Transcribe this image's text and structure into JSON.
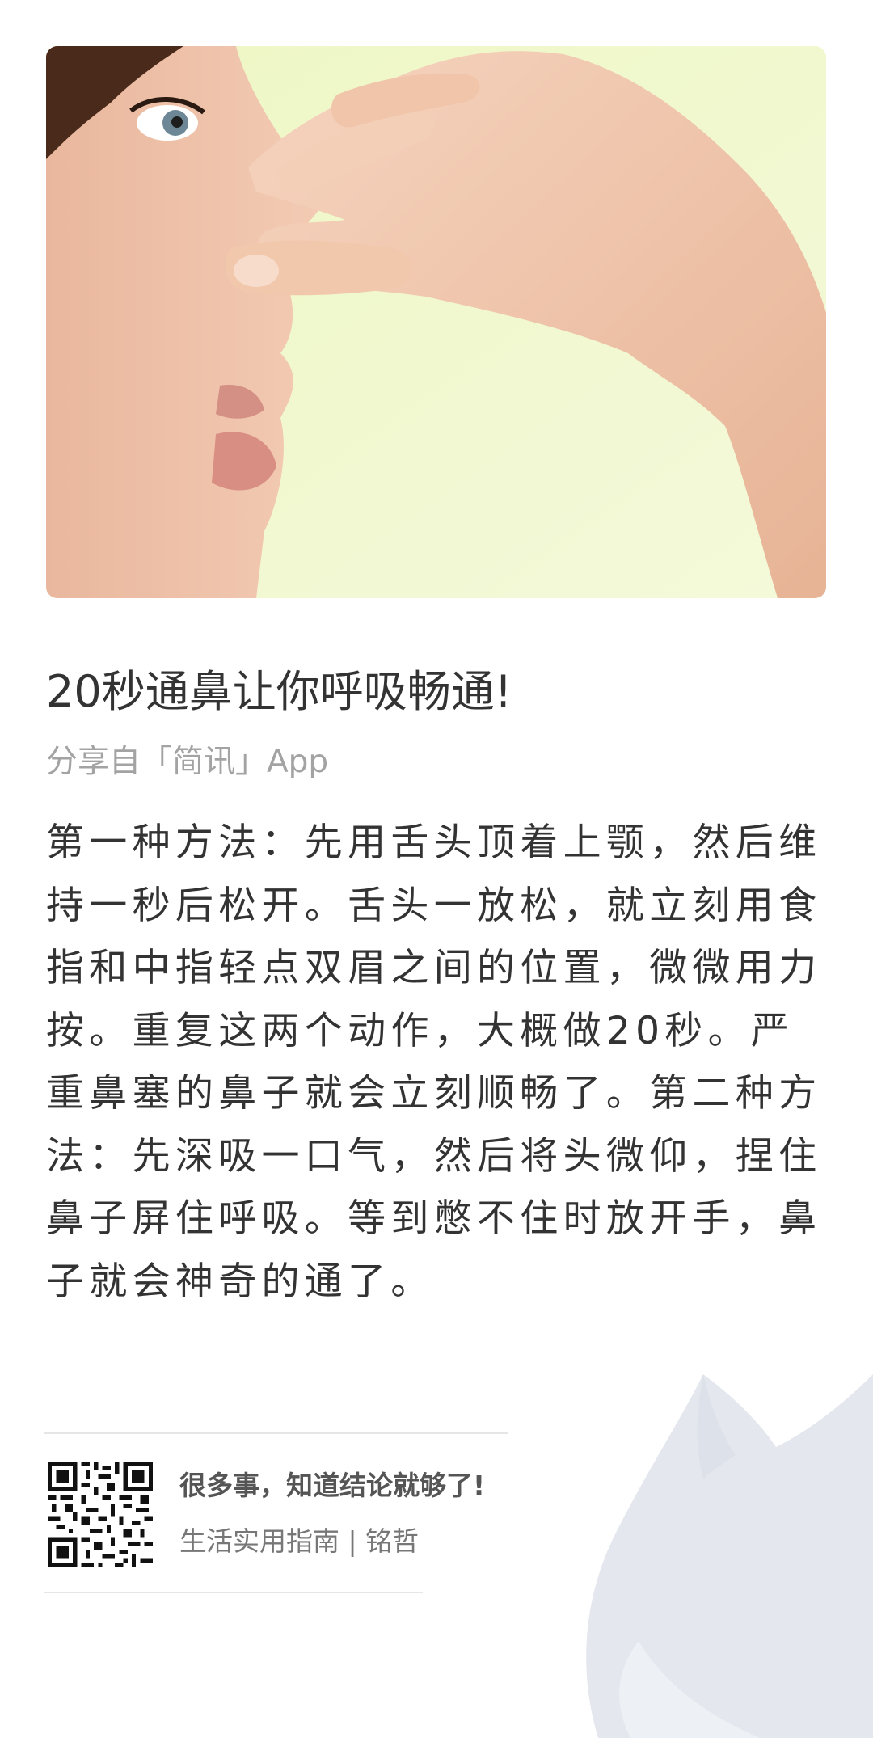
{
  "article": {
    "title": "20秒通鼻让你呼吸畅通!",
    "source": "分享自「简讯」App",
    "body": "第一种方法：先用舌头顶着上颚，然后维持一秒后松开。舌头一放松，就立刻用食指和中指轻点双眉之间的位置，微微用力按。重复这两个动作，大概做20秒。严重鼻塞的鼻子就会立刻顺畅了。第二种方法：先深吸一口气，然后将头微仰，捏住鼻子屏住呼吸。等到憋不住时放开手，鼻子就会神奇的通了。"
  },
  "hero_image": {
    "description_icon": "nose-pinch-photo"
  },
  "footer": {
    "slogan": "很多事，知道结论就够了!",
    "channel": "生活实用指南 | 铭哲",
    "qr_icon": "qr-code-icon",
    "watermark_icon": "fox-watermark-icon"
  },
  "colors": {
    "background": "#ffffff",
    "title": "#333333",
    "source": "#a3a3a3",
    "hero_background": "#f1f8cd",
    "watermark": "#e4e8ee"
  }
}
